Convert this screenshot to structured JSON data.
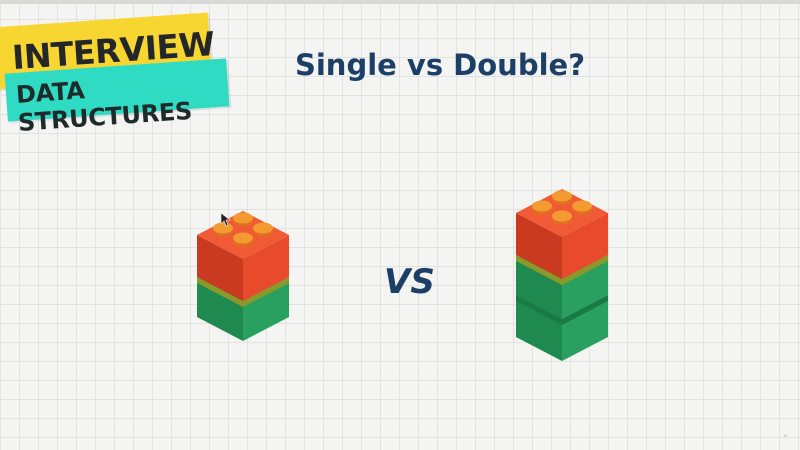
{
  "badge": {
    "line1": "INTERVIEW",
    "line2": "DATA STRUCTURES"
  },
  "title": "Single vs Double?",
  "vs_label": "VS",
  "colors": {
    "title": "#1b3f66",
    "badge_yellow": "#f8d631",
    "badge_teal": "#2fdcc3",
    "brick_red": "#e84a2c",
    "brick_orange": "#f08a2a",
    "brick_green": "#2aa060"
  },
  "stacks": [
    {
      "name": "single",
      "bricks": [
        "green",
        "red"
      ]
    },
    {
      "name": "double",
      "bricks": [
        "green",
        "green",
        "red"
      ]
    }
  ]
}
